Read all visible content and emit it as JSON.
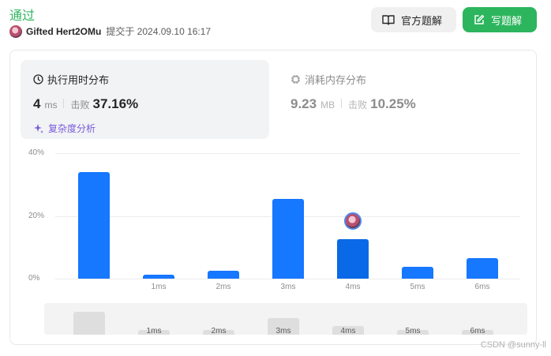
{
  "header": {
    "status": "通过",
    "user_name": "Gifted Hert2OMu",
    "submitted_text": "提交于 2024.09.10 16:17"
  },
  "buttons": {
    "official_solution": "官方题解",
    "write_solution": "写题解"
  },
  "runtime": {
    "title": "执行用时分布",
    "value": "4",
    "unit": "ms",
    "beats_label": "击败",
    "beats_pct": "37.16%",
    "analyze_label": "复杂度分析"
  },
  "memory": {
    "title": "消耗内存分布",
    "value": "9.23",
    "unit": "MB",
    "beats_label": "击败",
    "beats_pct": "10.25%"
  },
  "chart_data": {
    "type": "bar",
    "categories": [
      "",
      "1ms",
      "2ms",
      "3ms",
      "4ms",
      "5ms",
      "6ms"
    ],
    "values": [
      34,
      1.3,
      2.5,
      25.3,
      12.6,
      3.8,
      6.6
    ],
    "highlight_index": 4,
    "ytick_labels": [
      "40%",
      "20%",
      "0%"
    ],
    "yticks": [
      40,
      20,
      0
    ],
    "ylim": [
      0,
      40
    ],
    "grid": true,
    "navigator": {
      "labels": [
        "",
        "1ms",
        "2ms",
        "3ms",
        "4ms",
        "5ms",
        "6ms"
      ],
      "values": [
        34,
        1.3,
        2.5,
        25.3,
        12.6,
        3.8,
        6.6
      ]
    }
  },
  "colors": {
    "accent_green": "#2db55d",
    "bar_blue": "#1677ff",
    "analyze_purple": "#7a5bd8"
  },
  "watermark": "CSDN @sunny-ll"
}
